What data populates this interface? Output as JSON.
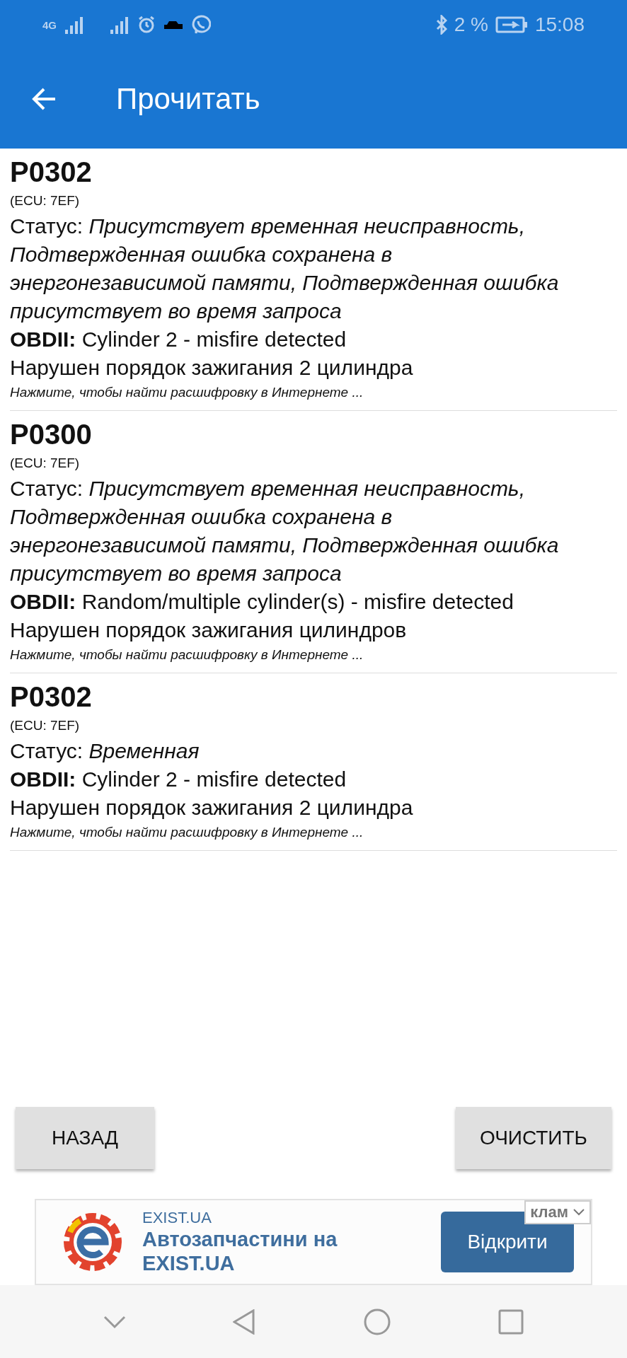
{
  "status_bar": {
    "network": "4G",
    "battery": "2 %",
    "time": "15:08"
  },
  "app_bar": {
    "title": "Прочитать"
  },
  "codes": [
    {
      "code": "P0302",
      "ecu": "(ECU: 7EF)",
      "status": "Статус: *Присутствует временная неисправность, Подтвержденная ошибка сохранена в энергонезависимой памяти, Подтвержденная ошибка присутствует во время запроса*",
      "obd": "**OBDII:** Cylinder 2 - misfire detected",
      "description": "Нарушен порядок зажигания 2 цилиндра",
      "hint": "Нажмите, чтобы найти расшифровку в Интернете ..."
    },
    {
      "code": "P0300",
      "ecu": "(ECU: 7EF)",
      "status": "Статус: *Присутствует временная неисправность, Подтвержденная ошибка сохранена в энергонезависимой памяти, Подтвержденная ошибка присутствует во время запроса*",
      "obd": "**OBDII:** Random/multiple cylinder(s) - misfire detected",
      "description": "Нарушен порядок зажигания цилиндров",
      "hint": "Нажмите, чтобы найти расшифровку в Интернете ..."
    },
    {
      "code": "P0302",
      "ecu": "(ECU: 7EF)",
      "status": "Статус: *Временная*",
      "obd": "**OBDII:** Cylinder 2 - misfire detected",
      "description": "Нарушен порядок зажигания 2 цилиндра",
      "hint": "Нажмите, чтобы найти расшифровку в Интернете ..."
    }
  ],
  "buttons": [
    "НАЗАД",
    "ОЧИСТИТЬ"
  ],
  "ad": {
    "label": "клам",
    "site": "EXIST.UA",
    "headline": "Автозапчастини на EXIST.UA",
    "action": "Відкрити"
  }
}
